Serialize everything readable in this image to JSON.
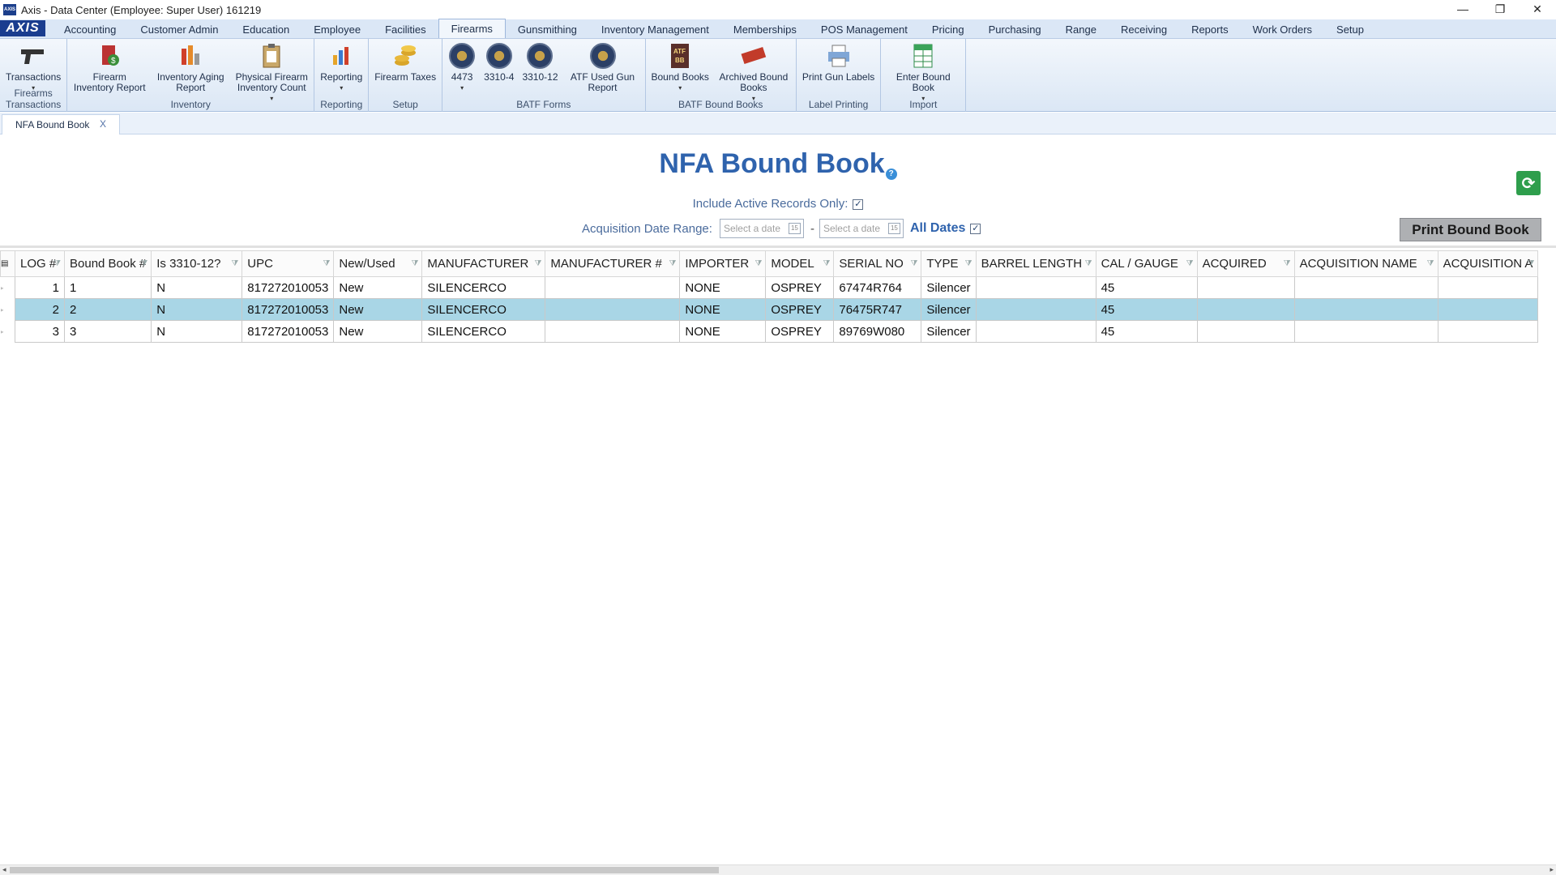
{
  "window": {
    "title": "Axis - Data Center  (Employee: Super User) 161219",
    "minimize": "—",
    "restore": "❐",
    "close": "✕"
  },
  "menu": {
    "logo": "AXIS",
    "items": [
      "Accounting",
      "Customer Admin",
      "Education",
      "Employee",
      "Facilities",
      "Firearms",
      "Gunsmithing",
      "Inventory Management",
      "Memberships",
      "POS Management",
      "Pricing",
      "Purchasing",
      "Range",
      "Receiving",
      "Reports",
      "Work Orders",
      "Setup"
    ],
    "active": "Firearms"
  },
  "ribbon": {
    "groups": [
      {
        "name": "Firearms Transactions",
        "buttons": [
          {
            "label": "Transactions",
            "icon": "pistol-icon",
            "dropdown": true
          }
        ]
      },
      {
        "name": "Inventory",
        "buttons": [
          {
            "label": "Firearm Inventory Report",
            "icon": "money-report-icon"
          },
          {
            "label": "Inventory Aging Report",
            "icon": "bar-report-icon"
          },
          {
            "label": "Physical Firearm Inventory Count",
            "icon": "clipboard-icon",
            "dropdown": true
          }
        ]
      },
      {
        "name": "Reporting",
        "buttons": [
          {
            "label": "Reporting",
            "icon": "chart-icon",
            "dropdown": true
          }
        ]
      },
      {
        "name": "Setup",
        "buttons": [
          {
            "label": "Firearm Taxes",
            "icon": "coins-icon"
          }
        ]
      },
      {
        "name": "BATF Forms",
        "buttons": [
          {
            "label": "4473",
            "icon": "atf-seal-icon",
            "dropdown": true
          },
          {
            "label": "3310-4",
            "icon": "atf-seal-icon"
          },
          {
            "label": "3310-12",
            "icon": "atf-seal-icon"
          },
          {
            "label": "ATF Used Gun Report",
            "icon": "atf-seal-icon"
          }
        ]
      },
      {
        "name": "BATF Bound Books",
        "buttons": [
          {
            "label": "Bound Books",
            "icon": "bound-book-icon",
            "dropdown": true
          },
          {
            "label": "Archived Bound Books",
            "icon": "archived-stamp-icon",
            "dropdown": true
          }
        ]
      },
      {
        "name": "Label Printing",
        "buttons": [
          {
            "label": "Print Gun Labels",
            "icon": "printer-icon"
          }
        ]
      },
      {
        "name": "Import",
        "buttons": [
          {
            "label": "Enter Bound Book",
            "icon": "spreadsheet-icon",
            "dropdown": true
          }
        ]
      }
    ]
  },
  "tabs": [
    {
      "label": "NFA Bound Book",
      "close": "X"
    }
  ],
  "page": {
    "title": "NFA Bound Book",
    "help": "?",
    "include_active_label": "Include Active Records Only:",
    "include_active_checked": true,
    "acq_range_label": "Acquisition Date Range:",
    "date_from_placeholder": "Select a date",
    "date_to_placeholder": "Select a date",
    "calendar_glyph": "15",
    "range_dash": "-",
    "all_dates_label": "All Dates",
    "all_dates_checked": true,
    "print_button": "Print Bound Book"
  },
  "grid": {
    "columns": [
      "LOG #",
      "Bound Book #",
      "Is 3310-12?",
      "UPC",
      "New/Used",
      "MANUFACTURER",
      "MANUFACTURER #",
      "IMPORTER",
      "MODEL",
      "SERIAL NO",
      "TYPE",
      "BARREL LENGTH",
      "CAL / GAUGE",
      "ACQUIRED",
      "ACQUISITION NAME",
      "ACQUISITION A"
    ],
    "rows": [
      [
        "1",
        "1",
        "N",
        "817272010053",
        "New",
        "SILENCERCO",
        "",
        "NONE",
        "OSPREY",
        "67474R764",
        "Silencer",
        "",
        "45",
        "",
        "",
        ""
      ],
      [
        "2",
        "2",
        "N",
        "817272010053",
        "New",
        "SILENCERCO",
        "",
        "NONE",
        "OSPREY",
        "76475R747",
        "Silencer",
        "",
        "45",
        "",
        "",
        ""
      ],
      [
        "3",
        "3",
        "N",
        "817272010053",
        "New",
        "SILENCERCO",
        "",
        "NONE",
        "OSPREY",
        "89769W080",
        "Silencer",
        "",
        "45",
        "",
        "",
        ""
      ]
    ],
    "selected_row": 1
  }
}
